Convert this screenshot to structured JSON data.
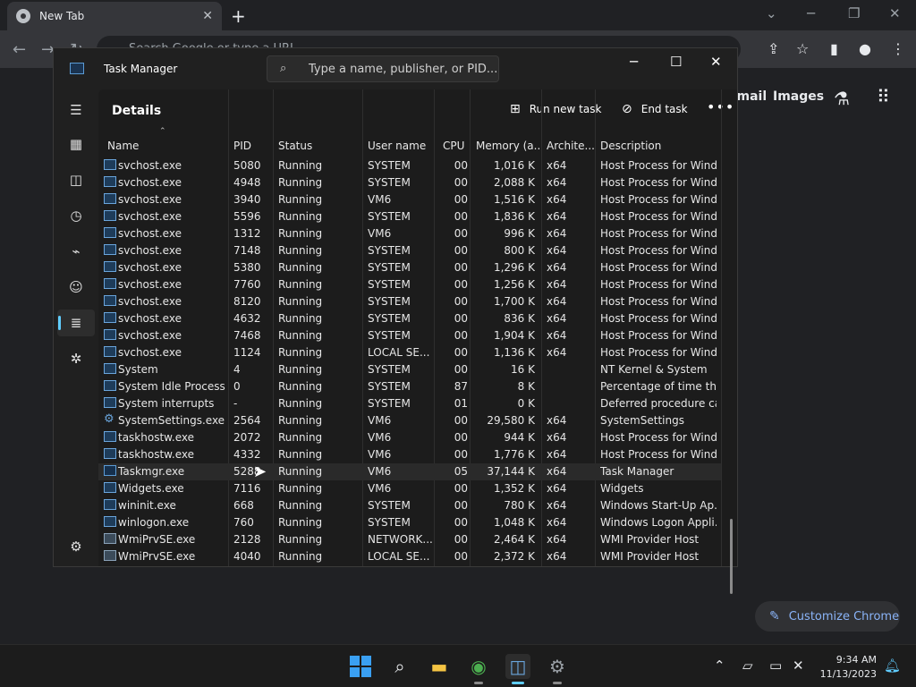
{
  "chrome": {
    "tab_title": "New Tab",
    "omnibox_placeholder": "Search Google or type a URL",
    "ntp_gmail": "Gmail",
    "ntp_images": "Images",
    "customize_label": "Customize Chrome"
  },
  "taskmgr": {
    "title": "Task Manager",
    "search_placeholder": "Type a name, publisher, or PID...",
    "heading": "Details",
    "run_new_task": "Run new task",
    "end_task": "End task",
    "columns": {
      "name": "Name",
      "pid": "PID",
      "status": "Status",
      "user": "User name",
      "cpu": "CPU",
      "memory": "Memory (a...",
      "arch": "Archite...",
      "desc": "Description"
    },
    "rows": [
      {
        "name": "svchost.exe",
        "pid": "5080",
        "status": "Running",
        "user": "SYSTEM",
        "cpu": "00",
        "mem": "1,016 K",
        "arch": "x64",
        "desc": "Host Process for Wind...",
        "icon": "window"
      },
      {
        "name": "svchost.exe",
        "pid": "4948",
        "status": "Running",
        "user": "SYSTEM",
        "cpu": "00",
        "mem": "2,088 K",
        "arch": "x64",
        "desc": "Host Process for Wind...",
        "icon": "window"
      },
      {
        "name": "svchost.exe",
        "pid": "3940",
        "status": "Running",
        "user": "VM6",
        "cpu": "00",
        "mem": "1,516 K",
        "arch": "x64",
        "desc": "Host Process for Wind...",
        "icon": "window"
      },
      {
        "name": "svchost.exe",
        "pid": "5596",
        "status": "Running",
        "user": "SYSTEM",
        "cpu": "00",
        "mem": "1,836 K",
        "arch": "x64",
        "desc": "Host Process for Wind...",
        "icon": "window"
      },
      {
        "name": "svchost.exe",
        "pid": "1312",
        "status": "Running",
        "user": "VM6",
        "cpu": "00",
        "mem": "996 K",
        "arch": "x64",
        "desc": "Host Process for Wind...",
        "icon": "window"
      },
      {
        "name": "svchost.exe",
        "pid": "7148",
        "status": "Running",
        "user": "SYSTEM",
        "cpu": "00",
        "mem": "800 K",
        "arch": "x64",
        "desc": "Host Process for Wind...",
        "icon": "window"
      },
      {
        "name": "svchost.exe",
        "pid": "5380",
        "status": "Running",
        "user": "SYSTEM",
        "cpu": "00",
        "mem": "1,296 K",
        "arch": "x64",
        "desc": "Host Process for Wind...",
        "icon": "window"
      },
      {
        "name": "svchost.exe",
        "pid": "7760",
        "status": "Running",
        "user": "SYSTEM",
        "cpu": "00",
        "mem": "1,256 K",
        "arch": "x64",
        "desc": "Host Process for Wind...",
        "icon": "window"
      },
      {
        "name": "svchost.exe",
        "pid": "8120",
        "status": "Running",
        "user": "SYSTEM",
        "cpu": "00",
        "mem": "1,700 K",
        "arch": "x64",
        "desc": "Host Process for Wind...",
        "icon": "window"
      },
      {
        "name": "svchost.exe",
        "pid": "4632",
        "status": "Running",
        "user": "SYSTEM",
        "cpu": "00",
        "mem": "836 K",
        "arch": "x64",
        "desc": "Host Process for Wind...",
        "icon": "window"
      },
      {
        "name": "svchost.exe",
        "pid": "7468",
        "status": "Running",
        "user": "SYSTEM",
        "cpu": "00",
        "mem": "1,904 K",
        "arch": "x64",
        "desc": "Host Process for Wind...",
        "icon": "window"
      },
      {
        "name": "svchost.exe",
        "pid": "1124",
        "status": "Running",
        "user": "LOCAL SE...",
        "cpu": "00",
        "mem": "1,136 K",
        "arch": "x64",
        "desc": "Host Process for Wind...",
        "icon": "window"
      },
      {
        "name": "System",
        "pid": "4",
        "status": "Running",
        "user": "SYSTEM",
        "cpu": "00",
        "mem": "16 K",
        "arch": "",
        "desc": "NT Kernel & System",
        "icon": "window"
      },
      {
        "name": "System Idle Process",
        "pid": "0",
        "status": "Running",
        "user": "SYSTEM",
        "cpu": "87",
        "mem": "8 K",
        "arch": "",
        "desc": "Percentage of time th...",
        "icon": "window"
      },
      {
        "name": "System interrupts",
        "pid": "-",
        "status": "Running",
        "user": "SYSTEM",
        "cpu": "01",
        "mem": "0 K",
        "arch": "",
        "desc": "Deferred procedure ca...",
        "icon": "window"
      },
      {
        "name": "SystemSettings.exe",
        "pid": "2564",
        "status": "Running",
        "user": "VM6",
        "cpu": "00",
        "mem": "29,580 K",
        "arch": "x64",
        "desc": "SystemSettings",
        "icon": "gear"
      },
      {
        "name": "taskhostw.exe",
        "pid": "2072",
        "status": "Running",
        "user": "VM6",
        "cpu": "00",
        "mem": "944 K",
        "arch": "x64",
        "desc": "Host Process for Wind...",
        "icon": "window"
      },
      {
        "name": "taskhostw.exe",
        "pid": "4332",
        "status": "Running",
        "user": "VM6",
        "cpu": "00",
        "mem": "1,776 K",
        "arch": "x64",
        "desc": "Host Process for Wind...",
        "icon": "window"
      },
      {
        "name": "Taskmgr.exe",
        "pid": "5288",
        "status": "Running",
        "user": "VM6",
        "cpu": "05",
        "mem": "37,144 K",
        "arch": "x64",
        "desc": "Task Manager",
        "icon": "tm",
        "selected": true
      },
      {
        "name": "Widgets.exe",
        "pid": "7116",
        "status": "Running",
        "user": "VM6",
        "cpu": "00",
        "mem": "1,352 K",
        "arch": "x64",
        "desc": "Widgets",
        "icon": "window"
      },
      {
        "name": "wininit.exe",
        "pid": "668",
        "status": "Running",
        "user": "SYSTEM",
        "cpu": "00",
        "mem": "780 K",
        "arch": "x64",
        "desc": "Windows Start-Up Ap...",
        "icon": "window"
      },
      {
        "name": "winlogon.exe",
        "pid": "760",
        "status": "Running",
        "user": "SYSTEM",
        "cpu": "00",
        "mem": "1,048 K",
        "arch": "x64",
        "desc": "Windows Logon Appli...",
        "icon": "window"
      },
      {
        "name": "WmiPrvSE.exe",
        "pid": "2128",
        "status": "Running",
        "user": "NETWORK...",
        "cpu": "00",
        "mem": "2,464 K",
        "arch": "x64",
        "desc": "WMI Provider Host",
        "icon": "wmi"
      },
      {
        "name": "WmiPrvSE.exe",
        "pid": "4040",
        "status": "Running",
        "user": "LOCAL SE...",
        "cpu": "00",
        "mem": "2,372 K",
        "arch": "x64",
        "desc": "WMI Provider Host",
        "icon": "wmi"
      }
    ]
  },
  "taskbar": {
    "time": "9:34 AM",
    "date": "11/13/2023"
  },
  "colors": {
    "accent": "#60cdff",
    "chrome_link": "#8ab4f8"
  }
}
